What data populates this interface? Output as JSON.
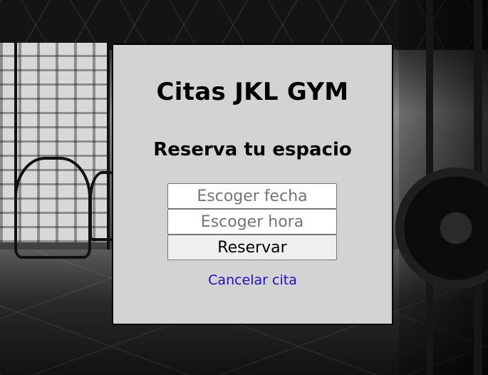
{
  "header": {
    "title": "Citas JKL GYM",
    "subtitle": "Reserva tu espacio"
  },
  "form": {
    "date_placeholder": "Escoger fecha",
    "time_placeholder": "Escoger hora",
    "submit_label": "Reservar"
  },
  "links": {
    "cancel_label": "Cancelar cita"
  },
  "colors": {
    "card_background": "#d3d3d3",
    "link": "#1a0dcc"
  }
}
